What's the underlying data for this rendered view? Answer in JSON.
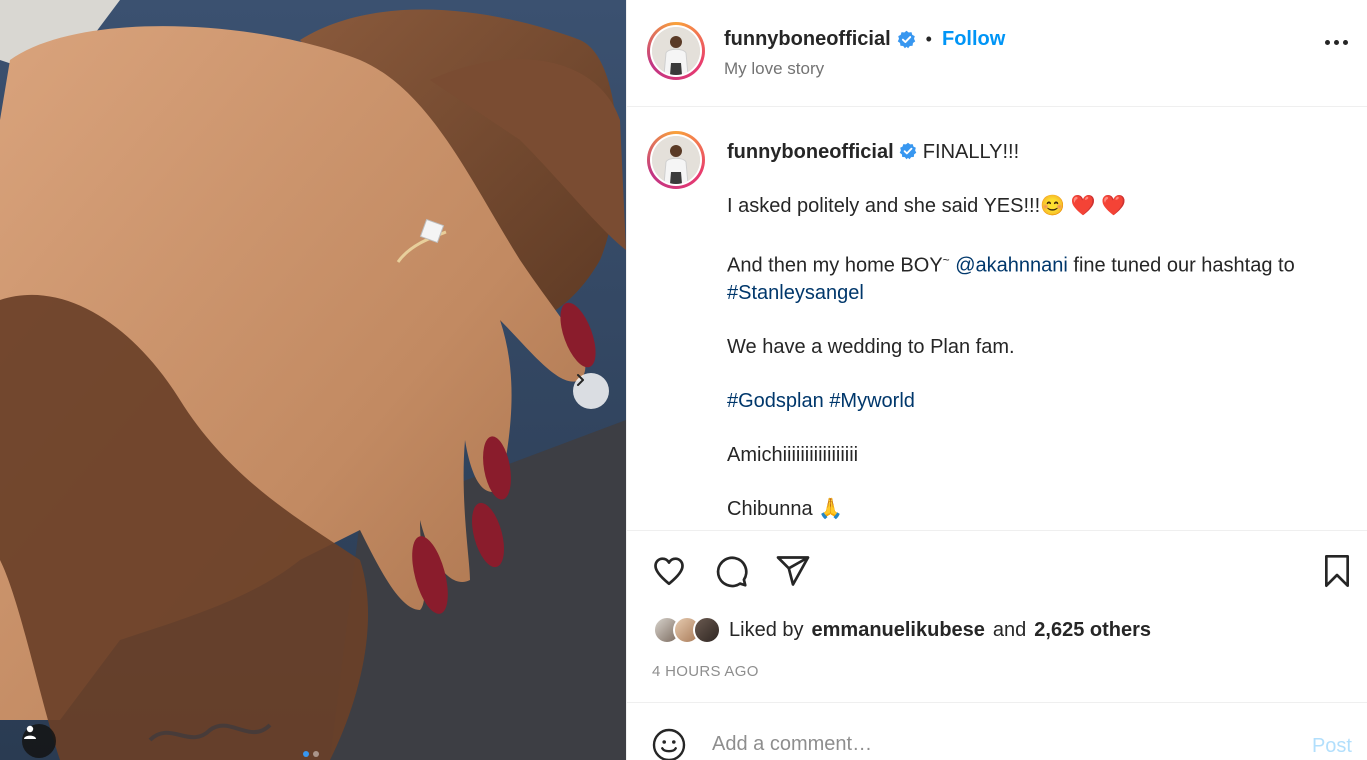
{
  "post": {
    "username": "funnyboneofficial",
    "follow_label": "Follow",
    "separator": "•",
    "location": "My love story"
  },
  "caption": {
    "username": "funnyboneofficial",
    "title": "FINALLY!!!",
    "line1": "I asked politely and she said YES!!!😊 ❤️ ❤️",
    "line2_prefix": "And then my home BOY",
    "line2_sup": "~",
    "line2_mention": "@akahnnani",
    "line2_suffix": " fine tuned our hashtag to",
    "line2_hashtag": "#Stanleysangel",
    "line3": "We have a wedding to Plan fam.",
    "hashtag_godsplan": "#Godsplan",
    "hashtag_myworld": "#Myworld",
    "line5": "Amichiiiiiiiiiiiiiiiii",
    "line6": "Chibunna 🙏"
  },
  "likes": {
    "prefix": "Liked by",
    "user": "emmanuelikubese",
    "joiner": "and",
    "others": "2,625 others"
  },
  "timestamp": "4 HOURS AGO",
  "comment": {
    "placeholder": "Add a comment…",
    "post_label": "Post"
  },
  "carousel": {
    "slide_count": 2,
    "active_slide": 1
  },
  "icons": {
    "verified": "verified-badge-icon",
    "more": "more-options-icon",
    "like": "heart-icon",
    "comment": "comment-bubble-icon",
    "share": "paper-plane-icon",
    "save": "bookmark-icon",
    "emoji": "smiley-icon",
    "next": "chevron-right-icon",
    "tag": "user-tag-icon"
  },
  "colors": {
    "accent": "#0095f6",
    "link": "#00376b",
    "muted": "#737373",
    "post_disabled": "#b2dffc"
  }
}
